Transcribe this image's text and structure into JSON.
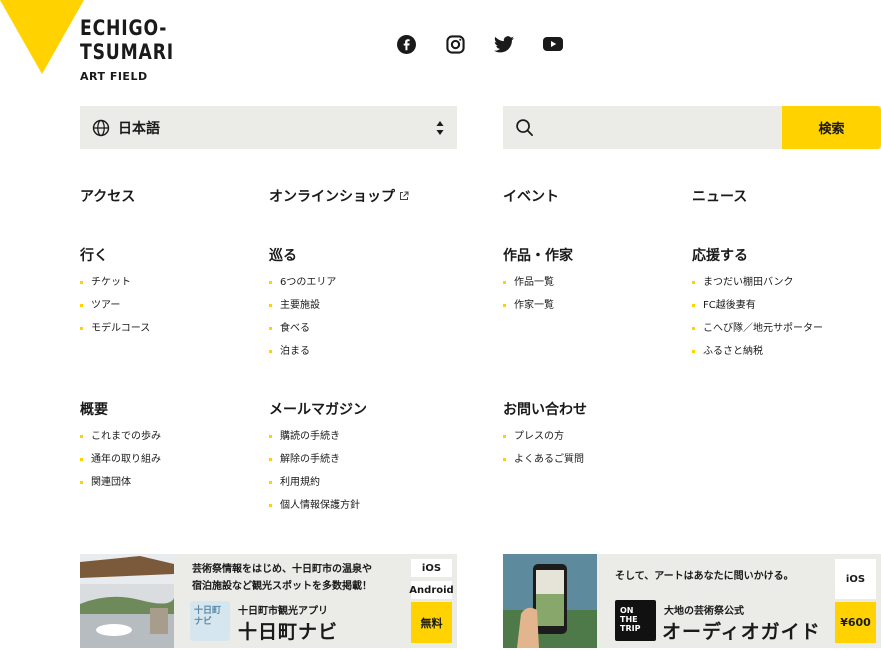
{
  "logo": {
    "line1": "ECHIGO-",
    "line2": "TSUMARI",
    "line3": "ART FIELD"
  },
  "social": [
    "facebook-icon",
    "instagram-icon",
    "twitter-icon",
    "youtube-icon"
  ],
  "language": {
    "selected": "日本語"
  },
  "search": {
    "placeholder": "",
    "button_label": "検索"
  },
  "top_links": [
    {
      "label": "アクセス"
    },
    {
      "label": "オンラインショップ",
      "external": true
    },
    {
      "label": "イベント"
    },
    {
      "label": "ニュース"
    }
  ],
  "sections": {
    "iku": {
      "title": "行く",
      "items": [
        "チケット",
        "ツアー",
        "モデルコース"
      ]
    },
    "meguru": {
      "title": "巡る",
      "items": [
        "6つのエリア",
        "主要施設",
        "食べる",
        "泊まる"
      ]
    },
    "sakuhin": {
      "title": "作品・作家",
      "items": [
        "作品一覧",
        "作家一覧"
      ]
    },
    "ouen": {
      "title": "応援する",
      "items": [
        "まつだい棚田バンク",
        "FC越後妻有",
        "こへび隊／地元サポーター",
        "ふるさと納税"
      ]
    },
    "gaiyou": {
      "title": "概要",
      "items": [
        "これまでの歩み",
        "通年の取り組み",
        "関連団体"
      ]
    },
    "mail": {
      "title": "メールマガジン",
      "items": [
        "購読の手続き",
        "解除の手続き",
        "利用規約",
        "個人情報保護方針"
      ]
    },
    "contact": {
      "title": "お問い合わせ",
      "items": [
        "プレスの方",
        "よくあるご質問"
      ]
    }
  },
  "banner_navi": {
    "desc_line1": "芸術祭情報をはじめ、十日町市の温泉や",
    "desc_line2": "宿泊施設など観光スポットを多数掲載！",
    "logo_text": "十日町ナビ",
    "subtitle": "十日町市観光アプリ",
    "title": "十日町ナビ",
    "badge_ios": "iOS",
    "badge_android": "Android",
    "badge_price": "無料"
  },
  "banner_guide": {
    "desc": "そして、アートはあなたに問いかける。",
    "logo_text": "ON THE TRIP",
    "subtitle": "大地の芸術祭公式",
    "title": "オーディオガイド",
    "badge_ios": "iOS",
    "badge_price": "¥600"
  },
  "colors": {
    "accent": "#ffd200",
    "field_bg": "#ebebe7",
    "text": "#1a1a1a"
  }
}
